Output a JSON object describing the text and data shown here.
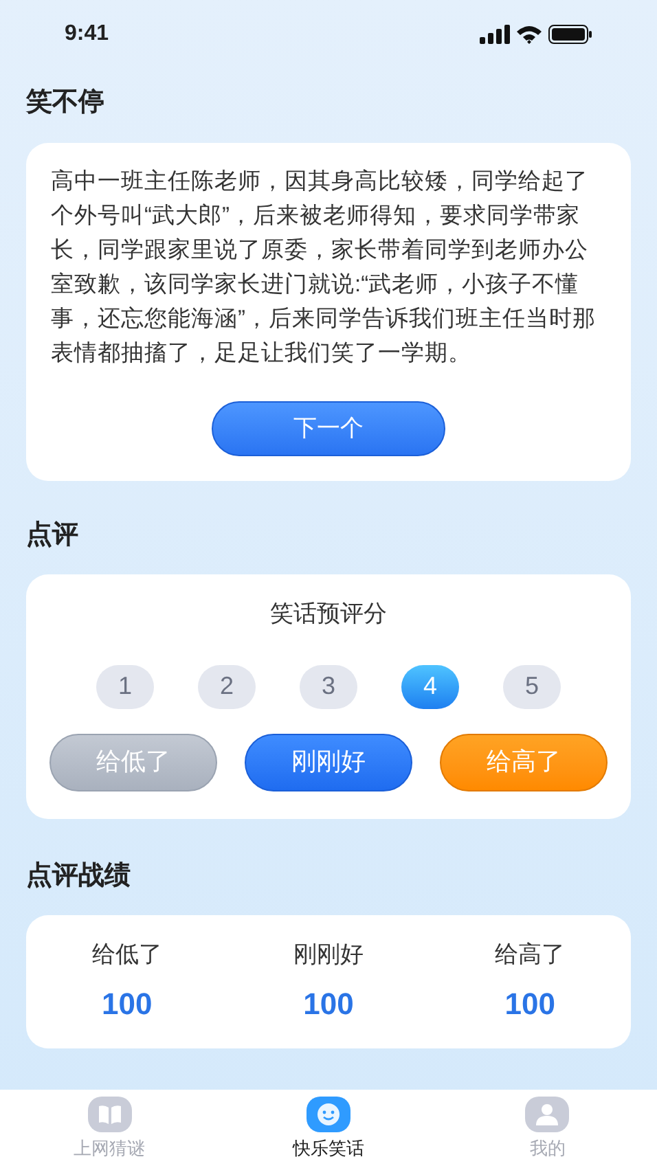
{
  "status_bar": {
    "time": "9:41"
  },
  "joke": {
    "title": "笑不停",
    "text": "高中一班主任陈老师，因其身高比较矮，同学给起了个外号叫“武大郎”，后来被老师得知，要求同学带家长，同学跟家里说了原委，家长带着同学到老师办公室致歉，该同学家长进门就说:“武老师，小孩子不懂事，还忘您能海涵”，后来同学告诉我们班主任当时那表情都抽搐了，足足让我们笑了一学期。",
    "next_button": "下一个"
  },
  "review": {
    "title": "点评",
    "subtitle": "笑话预评分",
    "scores": [
      {
        "label": "1",
        "selected": false
      },
      {
        "label": "2",
        "selected": false
      },
      {
        "label": "3",
        "selected": false
      },
      {
        "label": "4",
        "selected": true
      },
      {
        "label": "5",
        "selected": false
      }
    ],
    "verdicts": [
      {
        "label": "给低了",
        "kind": "low"
      },
      {
        "label": "刚刚好",
        "kind": "right"
      },
      {
        "label": "给高了",
        "kind": "high"
      }
    ]
  },
  "record": {
    "title": "点评战绩",
    "stats": [
      {
        "label": "给低了",
        "value": "100"
      },
      {
        "label": "刚刚好",
        "value": "100"
      },
      {
        "label": "给高了",
        "value": "100"
      }
    ]
  },
  "tabs": [
    {
      "label": "上网猜谜",
      "kind": "book",
      "selected": false
    },
    {
      "label": "快乐笑话",
      "kind": "smile",
      "selected": true
    },
    {
      "label": "我的",
      "kind": "person",
      "selected": false
    }
  ]
}
